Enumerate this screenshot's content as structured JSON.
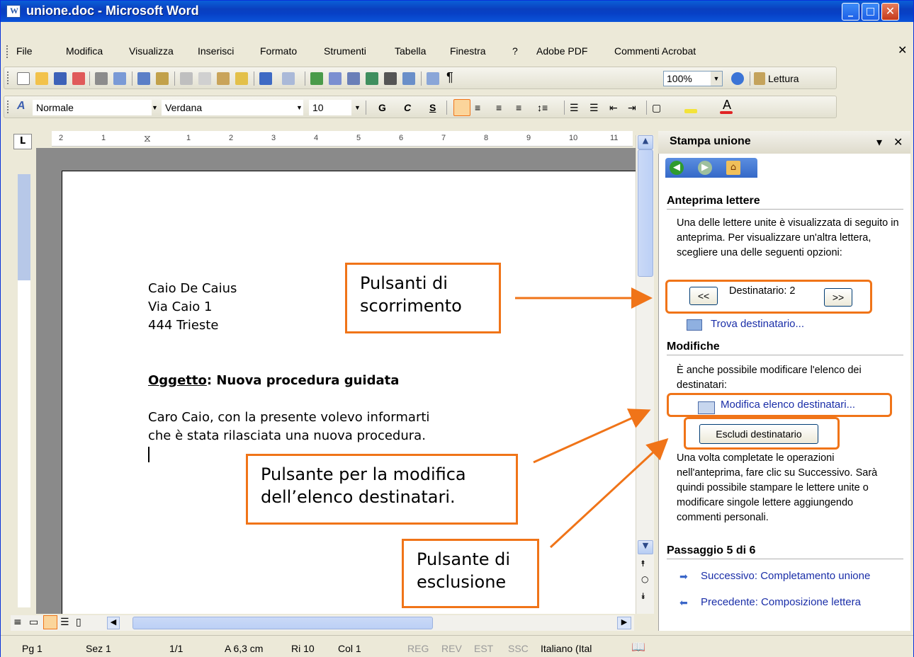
{
  "window": {
    "title": "unione.doc - Microsoft Word"
  },
  "menu": {
    "items": [
      "File",
      "Modifica",
      "Visualizza",
      "Inserisci",
      "Formato",
      "Strumenti",
      "Tabella",
      "Finestra",
      "?",
      "Adobe PDF",
      "Commenti Acrobat"
    ]
  },
  "toolbar": {
    "zoom": "100%",
    "reading": "Lettura",
    "style": "Normale",
    "font": "Verdana",
    "size": "10",
    "bold": "G",
    "italic": "C",
    "underline": "S"
  },
  "ruler": {
    "labels": [
      "2",
      "1",
      "1",
      "2",
      "3",
      "4",
      "5",
      "6",
      "7",
      "8",
      "9",
      "10",
      "11"
    ]
  },
  "document": {
    "address": [
      "Caio De Caius",
      "Via Caio 1",
      "444 Trieste"
    ],
    "subject_label": "Oggetto",
    "subject_text": ": Nuova procedura guidata",
    "body": [
      "Caro Caio, con la presente volevo informarti",
      "che è stata rilasciata una nuova procedura."
    ]
  },
  "taskpane": {
    "title": "Stampa unione",
    "preview_heading": "Anteprima lettere",
    "preview_text": "Una delle lettere unite è visualizzata di seguito in anteprima. Per visualizzare un'altra lettera, scegliere una delle seguenti opzioni:",
    "prev_btn": "<<",
    "next_btn": ">>",
    "recipient": "Destinatario: 2",
    "find_link": "Trova destinatario...",
    "changes_heading": "Modifiche",
    "changes_text": "È anche possibile modificare l'elenco dei destinatari:",
    "edit_link": "Modifica elenco destinatari...",
    "exclude_btn": "Escludi destinatario",
    "after_text": "Una volta completate le operazioni nell'anteprima, fare clic su Successivo. Sarà quindi possibile stampare le lettere unite o modificare singole lettere aggiungendo commenti personali.",
    "step": "Passaggio 5 di 6",
    "next_link": "Successivo: Completamento unione",
    "prev_link": "Precedente: Composizione lettera"
  },
  "callouts": {
    "scroll": "Pulsanti di scorrimento",
    "edit": "Pulsante per la modifica dell’elenco destinatari.",
    "exclude": "Pulsante di esclusione"
  },
  "status": {
    "page": "Pg 1",
    "section": "Sez 1",
    "pages": "1/1",
    "at": "A 6,3 cm",
    "line": "Ri 10",
    "col": "Col 1",
    "rec": "REG",
    "rev": "REV",
    "ext": "EST",
    "ovr": "SSC",
    "lang": "Italiano (Ital"
  },
  "colors": {
    "callout_border": "#f07418",
    "title_bar": "#0a3fbe",
    "link": "#1a2ea8"
  }
}
